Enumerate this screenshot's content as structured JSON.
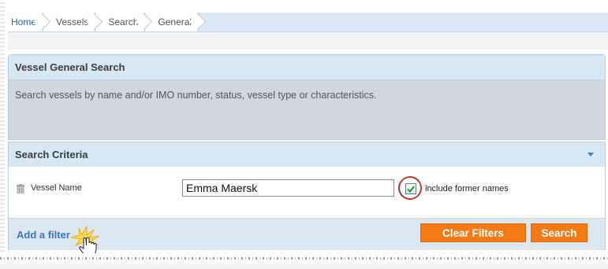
{
  "breadcrumb": {
    "items": [
      "Home",
      "Vessels",
      "Search",
      "General"
    ]
  },
  "general_panel": {
    "title": "Vessel General Search",
    "description": "Search vessels by name and/or IMO number, status, vessel type or characteristics."
  },
  "criteria_panel": {
    "title": "Search Criteria",
    "field": {
      "label": "Vessel Name",
      "value": "Emma Maersk",
      "checkbox_label": "include former names",
      "checkbox_checked": true
    },
    "add_filter_label": "Add a filter",
    "clear_button_label": "Clear Filters",
    "search_button_label": "Search"
  },
  "colors": {
    "accent_button": "#f47a16",
    "panel_header": "#d6e7f6",
    "link": "#3a75c4",
    "highlight_ring": "#c0392b"
  },
  "icons": [
    "trash-icon",
    "dropdown-caret-icon",
    "checkmark-icon",
    "pointer-hand-icon",
    "click-burst-icon"
  ]
}
